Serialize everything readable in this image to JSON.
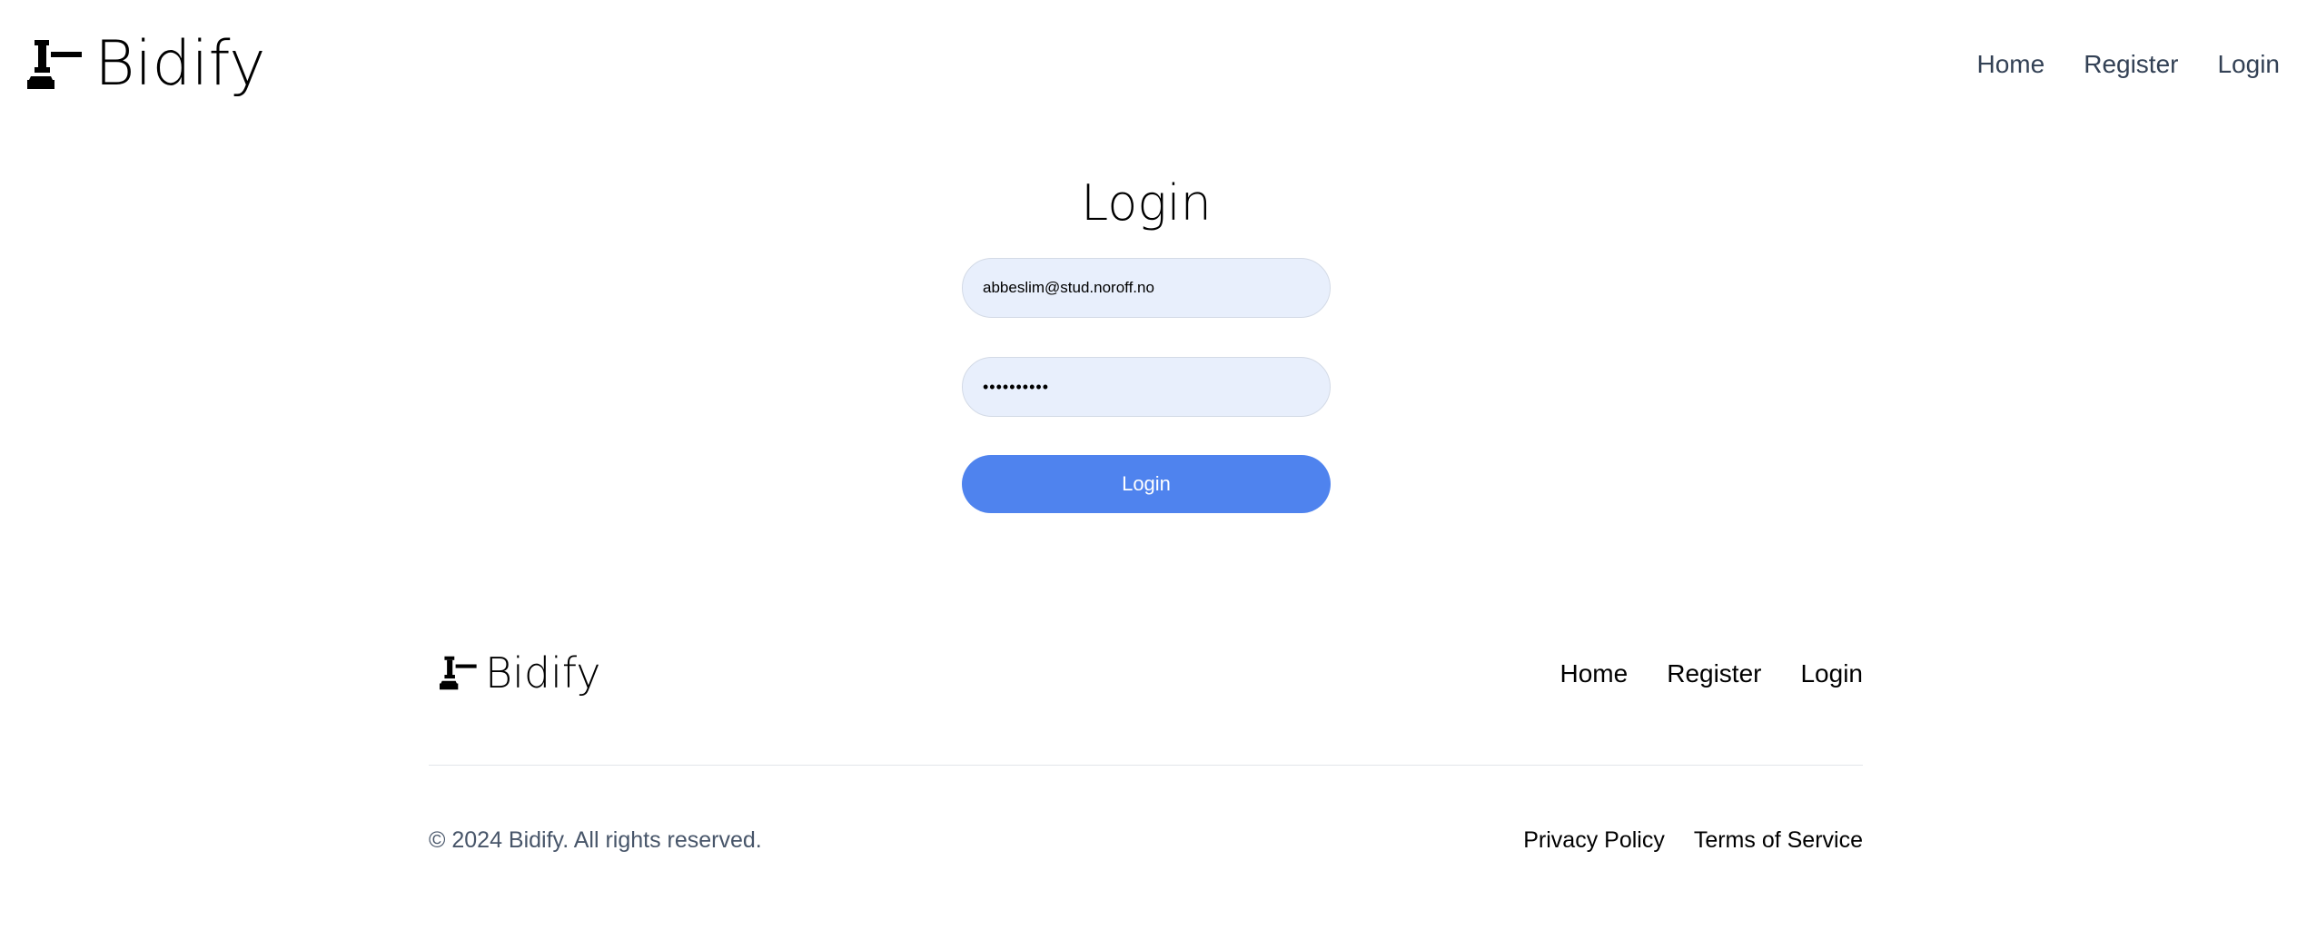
{
  "header": {
    "logo_text": "Bidify",
    "nav": [
      {
        "label": "Home"
      },
      {
        "label": "Register"
      },
      {
        "label": "Login"
      }
    ]
  },
  "login": {
    "title": "Login",
    "email_value": "abbeslim@stud.noroff.no",
    "password_value": "••••••••••",
    "button_label": "Login"
  },
  "footer": {
    "logo_text": "Bidify",
    "nav": [
      {
        "label": "Home"
      },
      {
        "label": "Register"
      },
      {
        "label": "Login"
      }
    ],
    "copyright": "© 2024 Bidify. All rights reserved.",
    "legal": [
      {
        "label": "Privacy Policy"
      },
      {
        "label": "Terms of Service"
      }
    ]
  },
  "colors": {
    "accent": "#4f83ee",
    "input_bg": "#e8effc",
    "nav_text": "#334155",
    "muted_text": "#475569"
  },
  "icons": {
    "logo": "gavel-icon"
  }
}
